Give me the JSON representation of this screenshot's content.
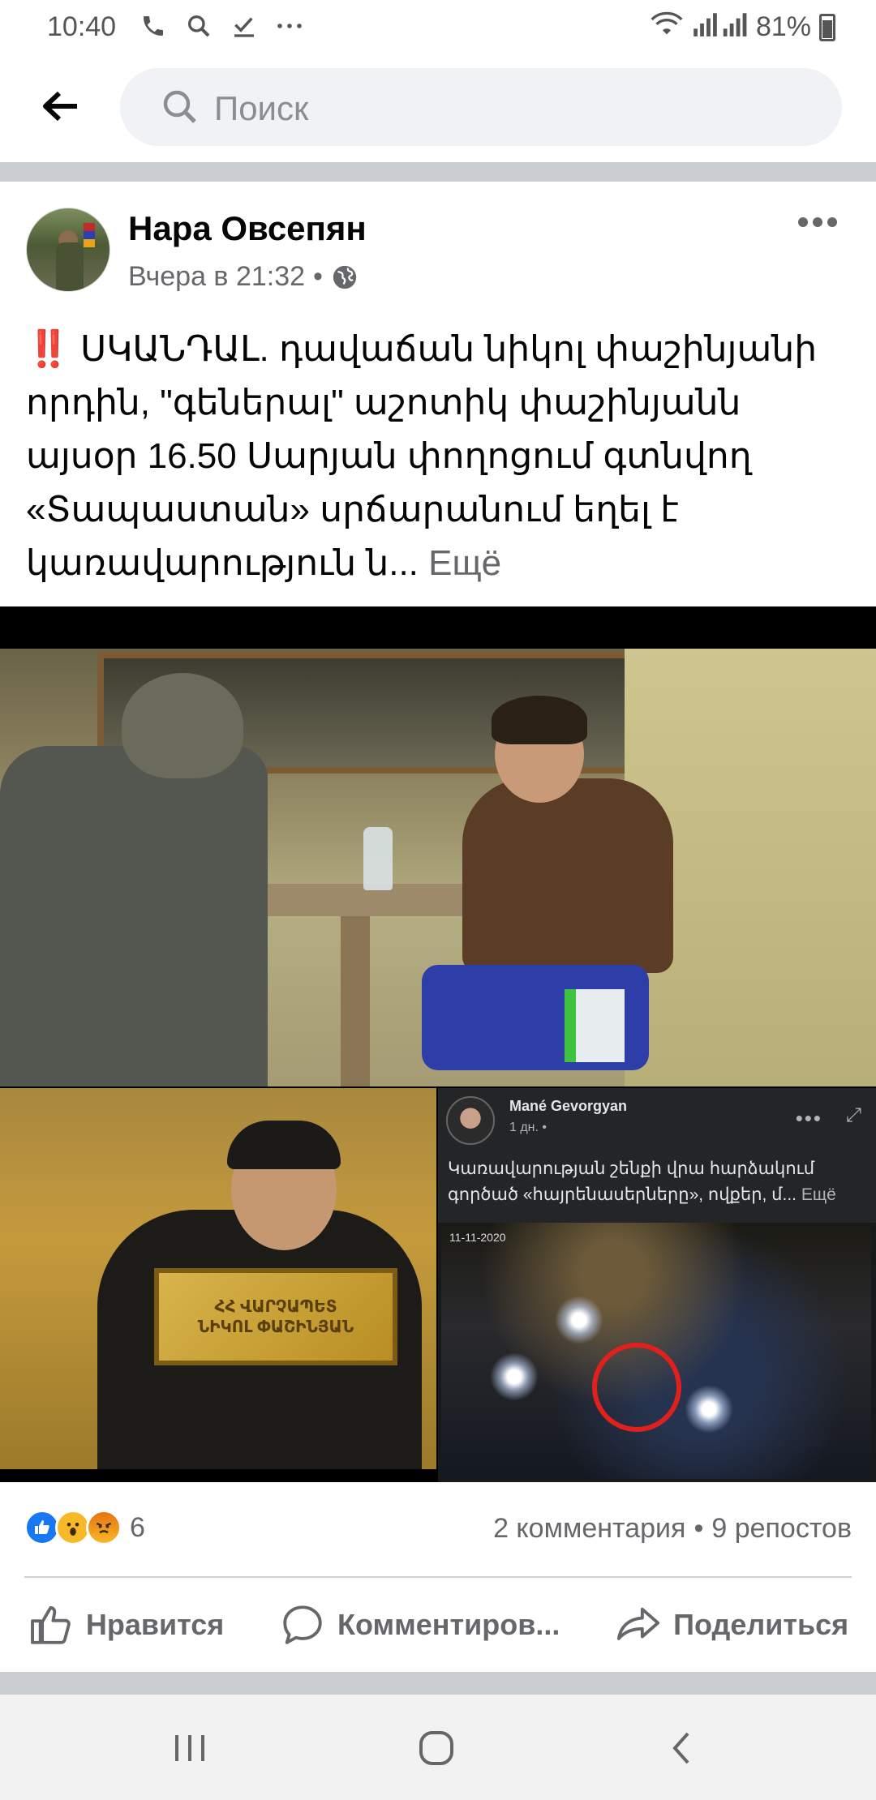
{
  "status_bar": {
    "time": "10:40",
    "battery": "81%",
    "icons": [
      "phone-icon",
      "search-icon",
      "check-icon",
      "more-icon",
      "wifi-icon",
      "signal-icon",
      "battery-icon"
    ]
  },
  "header": {
    "search_placeholder": "Поиск"
  },
  "post": {
    "author": "Нара Овсепян",
    "time": "Вчера в 21:32",
    "separator": "•",
    "audience_icon": "globe-icon",
    "text_prefix": "‼️",
    "text": " ՍԿԱՆԴԱԼ. դավաճան նիկոլ փաշինյանի որդին, \"գեներալ\" աշոտիկ փաշինյանն այսօր 16.50 Սարյան փողոցում գտնվող «Տապաստան» սրճարանում եղել է կառավարություն ն...",
    "see_more": " Ещё",
    "photo": {
      "sign_line1": "ՀՀ ՎԱՐՉԱՊԵՏ",
      "sign_line2": "ՆԻԿՈԼ ՓԱՇԻՆՅԱՆ",
      "embedded_post": {
        "author": "Mané Gevorgyan",
        "meta": "1 дн. •",
        "text": "Կառավարության շենքի վրա հարձակում գործած «հայրենասերները», ովքեր, մ...",
        "see_more": " Ещё",
        "timestamp": "11-11-2020"
      }
    },
    "reactions": {
      "count": "6",
      "comments": "2 комментария",
      "dot": "•",
      "shares": "9 репостов"
    },
    "actions": {
      "like": "Нравится",
      "comment": "Комментиров...",
      "share": "Поделиться"
    }
  },
  "colors": {
    "accent": "#1877f2",
    "secondary_text": "#65676b",
    "separator": "#c9ccd1"
  }
}
